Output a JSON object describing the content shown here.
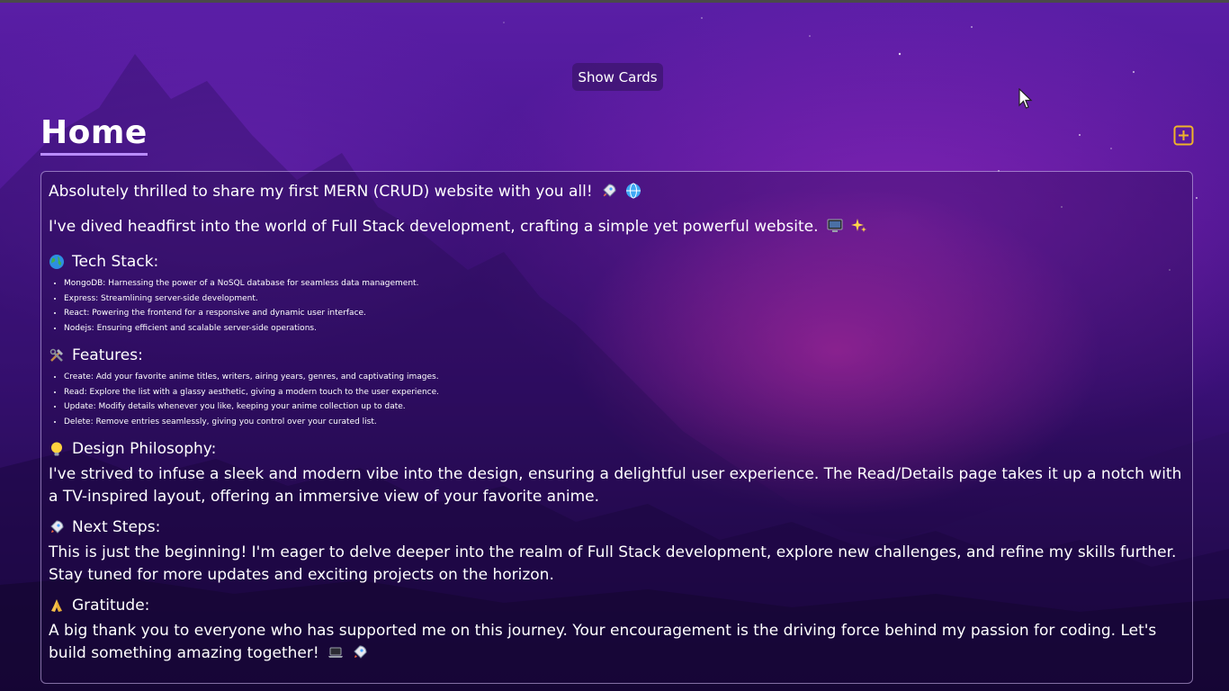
{
  "header": {
    "show_cards_label": "Show Cards",
    "page_title": "Home"
  },
  "post": {
    "intro": "Absolutely thrilled to share my first MERN (CRUD) website with you all!",
    "intro_icons": [
      "rocket-icon",
      "globe-icon"
    ],
    "subintro": "I've dived headfirst into the world of Full Stack development, crafting a simple yet powerful website.",
    "subintro_icons": [
      "computer-icon",
      "sparkles-icon"
    ],
    "sections": {
      "tech_stack": {
        "heading": "Tech Stack:",
        "icon": "earth-icon",
        "items": [
          "MongoDB: Harnessing the power of a NoSQL database for seamless data management.",
          "Express: Streamlining server-side development.",
          "React: Powering the frontend for a responsive and dynamic user interface.",
          "Nodejs: Ensuring efficient and scalable server-side operations."
        ]
      },
      "features": {
        "heading": "Features:",
        "icon": "tools-icon",
        "items": [
          "Create: Add your favorite anime titles, writers, airing years, genres, and captivating images.",
          "Read: Explore the list with a glassy aesthetic, giving a modern touch to the user experience.",
          "Update: Modify details whenever you like, keeping your anime collection up to date.",
          "Delete: Remove entries seamlessly, giving you control over your curated list."
        ]
      },
      "design": {
        "heading": "Design Philosophy:",
        "icon": "bulb-icon",
        "body": "I've strived to infuse a sleek and modern vibe into the design, ensuring a delightful user experience. The Read/Details page takes it up a notch with a TV-inspired layout, offering an immersive view of your favorite anime."
      },
      "next_steps": {
        "heading": "Next Steps:",
        "icon": "rocket-icon",
        "body": "This is just the beginning! I'm eager to delve deeper into the realm of Full Stack development, explore new challenges, and refine my skills further. Stay tuned for more updates and exciting projects on the horizon."
      },
      "gratitude": {
        "heading": "Gratitude:",
        "icon": "praying-hands-icon",
        "body": "A big thank you to everyone who has supported me on this journey. Your encouragement is the driving force behind my passion for coding. Let's build something amazing together!",
        "body_icons": [
          "laptop-icon",
          "rocket-icon"
        ]
      }
    }
  },
  "colors": {
    "accent_underline": "#b98cff",
    "add_icon": "#f0b429",
    "text": "#ffffff"
  }
}
